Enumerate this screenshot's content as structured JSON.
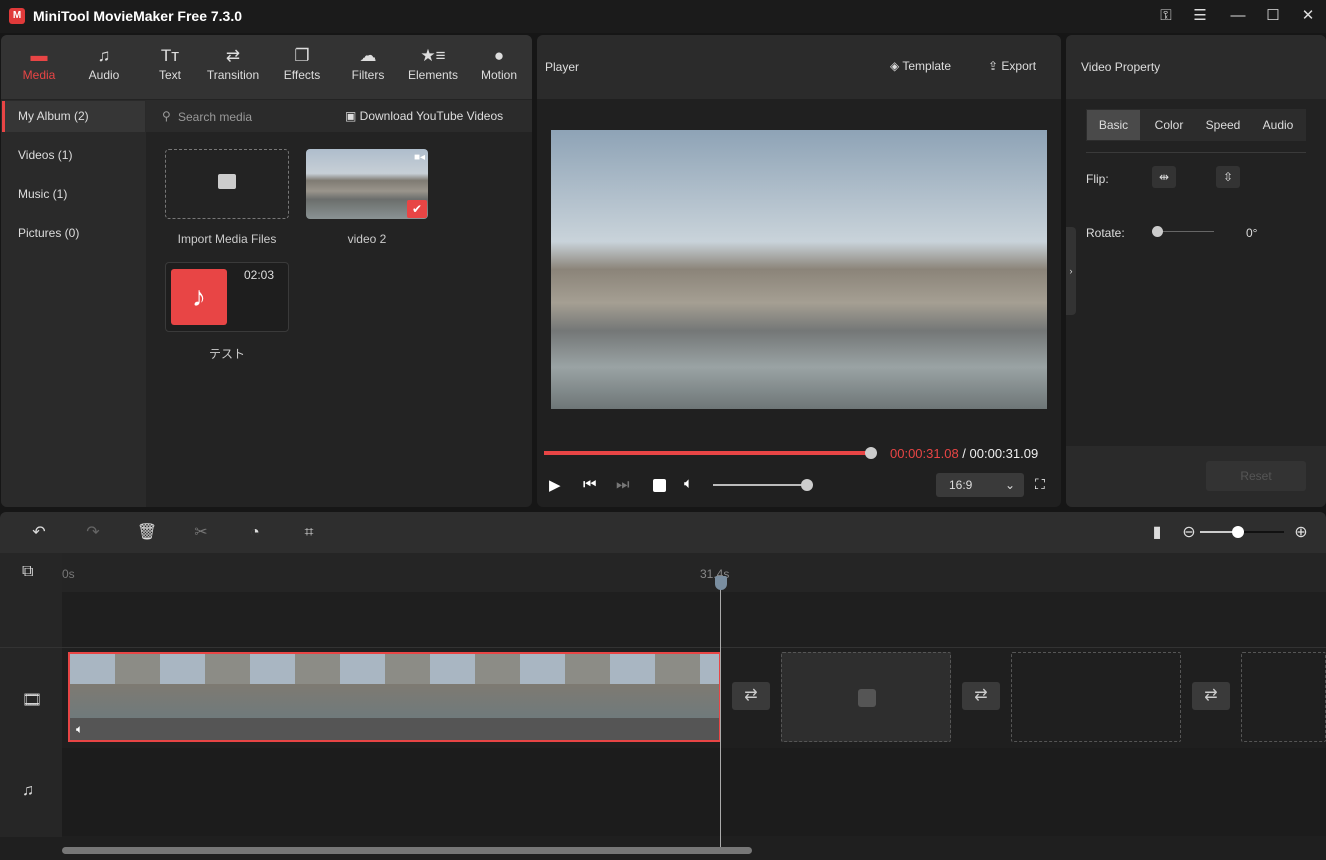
{
  "app": {
    "title": "MiniTool MovieMaker Free 7.3.0",
    "logo_letter": "M"
  },
  "window_controls": [
    {
      "icon": "key-icon",
      "glyph": "⚿"
    },
    {
      "icon": "menu-icon",
      "glyph": "☰"
    },
    {
      "icon": "minimize-icon",
      "glyph": "—"
    },
    {
      "icon": "maximize-icon",
      "glyph": "☐"
    },
    {
      "icon": "close-icon",
      "glyph": "✕"
    }
  ],
  "toolbar": [
    {
      "label": "Media",
      "icon": "folder-icon",
      "glyph": "▬",
      "active": true
    },
    {
      "label": "Audio",
      "icon": "music-icon",
      "glyph": "♫"
    },
    {
      "label": "Text",
      "icon": "text-icon",
      "glyph": "Tт"
    },
    {
      "label": "Transition",
      "icon": "transition-icon",
      "glyph": "⇄"
    },
    {
      "label": "Effects",
      "icon": "effects-icon",
      "glyph": "❐"
    },
    {
      "label": "Filters",
      "icon": "filters-icon",
      "glyph": "☁"
    },
    {
      "label": "Elements",
      "icon": "elements-icon",
      "glyph": "★≡"
    },
    {
      "label": "Motion",
      "icon": "motion-icon",
      "glyph": "●"
    }
  ],
  "sidebar": [
    {
      "label": "My Album (2)",
      "active": true
    },
    {
      "label": "Videos (1)"
    },
    {
      "label": "Music (1)"
    },
    {
      "label": "Pictures (0)"
    }
  ],
  "media": {
    "search_placeholder": "Search media",
    "download_label": "Download YouTube Videos",
    "import_label": "Import Media Files",
    "video_label": "video 2",
    "audio_label": "テスト",
    "audio_duration": "02:03"
  },
  "player": {
    "title": "Player",
    "template_label": "Template",
    "export_label": "Export",
    "current_time": "00:00:31.08",
    "total_time": " / 00:00:31.09",
    "progress": 1.0,
    "volume": 1.0,
    "aspect": "16:9"
  },
  "property": {
    "title": "Video Property",
    "tabs": [
      "Basic",
      "Color",
      "Speed",
      "Audio"
    ],
    "active_tab": "Basic",
    "flip_label": "Flip:",
    "rotate_label": "Rotate:",
    "rotate_value": "0°",
    "reset_label": "Reset"
  },
  "timeline": {
    "ruler_start": "0s",
    "playhead_time": "31.4s",
    "zoom": 0.4
  },
  "colors": {
    "accent": "#e84545"
  }
}
